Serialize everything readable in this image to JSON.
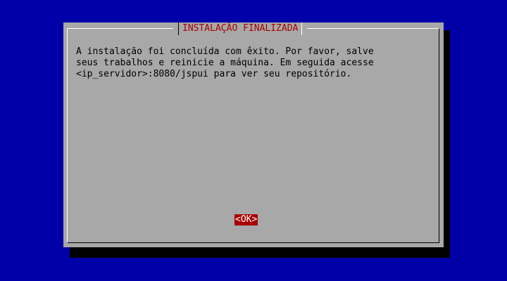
{
  "dialog": {
    "title": "INSTALAÇÃO FINALIZADA",
    "message_lines": [
      "A instalação foi concluída com êxito. Por favor, salve",
      "seus trabalhos e reinicie a máquina. Em seguida acesse",
      "<ip_servidor>:8080/jspui para ver seu repositório."
    ],
    "ok_label": "<OK>"
  },
  "colors": {
    "background": "#0000a8",
    "dialog": "#a8a8a8",
    "title_text": "#a80000",
    "button_active": "#a80000",
    "button_text": "#ffffff"
  }
}
